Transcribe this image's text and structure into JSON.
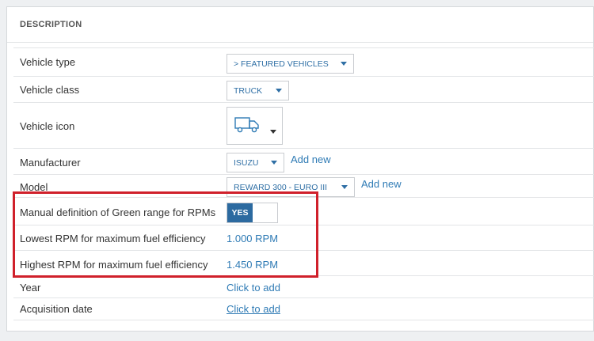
{
  "panel": {
    "title": "DESCRIPTION"
  },
  "rows": {
    "vehicle_type": {
      "label": "Vehicle type",
      "value": "> FEATURED VEHICLES"
    },
    "vehicle_class": {
      "label": "Vehicle class",
      "value": "TRUCK"
    },
    "vehicle_icon": {
      "label": "Vehicle icon",
      "icon": "truck-icon"
    },
    "manufacturer": {
      "label": "Manufacturer",
      "value": "ISUZU",
      "add_new": "Add new"
    },
    "model": {
      "label": "Model",
      "value": "REWARD 300 - EURO III",
      "add_new": "Add new"
    },
    "green_range": {
      "label": "Manual definition of Green range for RPMs",
      "toggle": "YES"
    },
    "lowest_rpm": {
      "label": "Lowest RPM for maximum fuel efficiency",
      "value": "1.000 RPM"
    },
    "highest_rpm": {
      "label": "Highest RPM for maximum fuel efficiency",
      "value": "1.450 RPM"
    },
    "year": {
      "label": "Year",
      "value": "Click to add"
    },
    "acquisition_date": {
      "label": "Acquisition date",
      "value": "Click to add"
    }
  },
  "colors": {
    "accent": "#2c6aa0",
    "link": "#2f7bb5",
    "highlight": "#d0202b"
  }
}
